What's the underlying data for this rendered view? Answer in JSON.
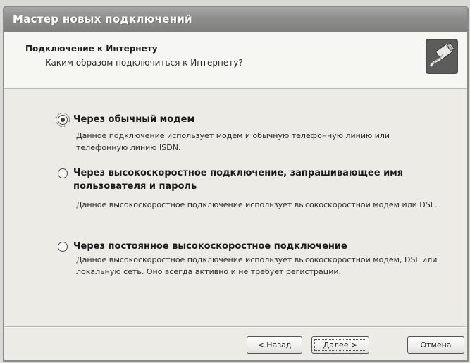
{
  "window": {
    "title": "Мастер новых подключений"
  },
  "header": {
    "title": "Подключение к Интернету",
    "subtitle": "Каким образом подключиться к Интернету?",
    "icon": "network-cable-icon"
  },
  "options": [
    {
      "label": "Через обычный модем",
      "description": "Данное подключение использует модем и обычную телефонную линию или телефонную линию ISDN.",
      "selected": true
    },
    {
      "label": "Через высокоскоростное подключение, запрашивающее имя пользователя и пароль",
      "description": "Данное высокоскоростное подключение использует высокоскоростной модем или DSL.",
      "selected": false
    },
    {
      "label": "Через постоянное высокоскоростное подключение",
      "description": "Данное высокоскоростное подключение использует высокоскоростной модем, DSL или локальную сеть. Оно всегда активно и не требует регистрации.",
      "selected": false
    }
  ],
  "buttons": {
    "back": "< Назад",
    "next": "Далее >",
    "cancel": "Отмена"
  },
  "colors": {
    "titlebar": "#8e8e8c",
    "background": "#ecebe6",
    "header_background": "#f6f6f3"
  }
}
